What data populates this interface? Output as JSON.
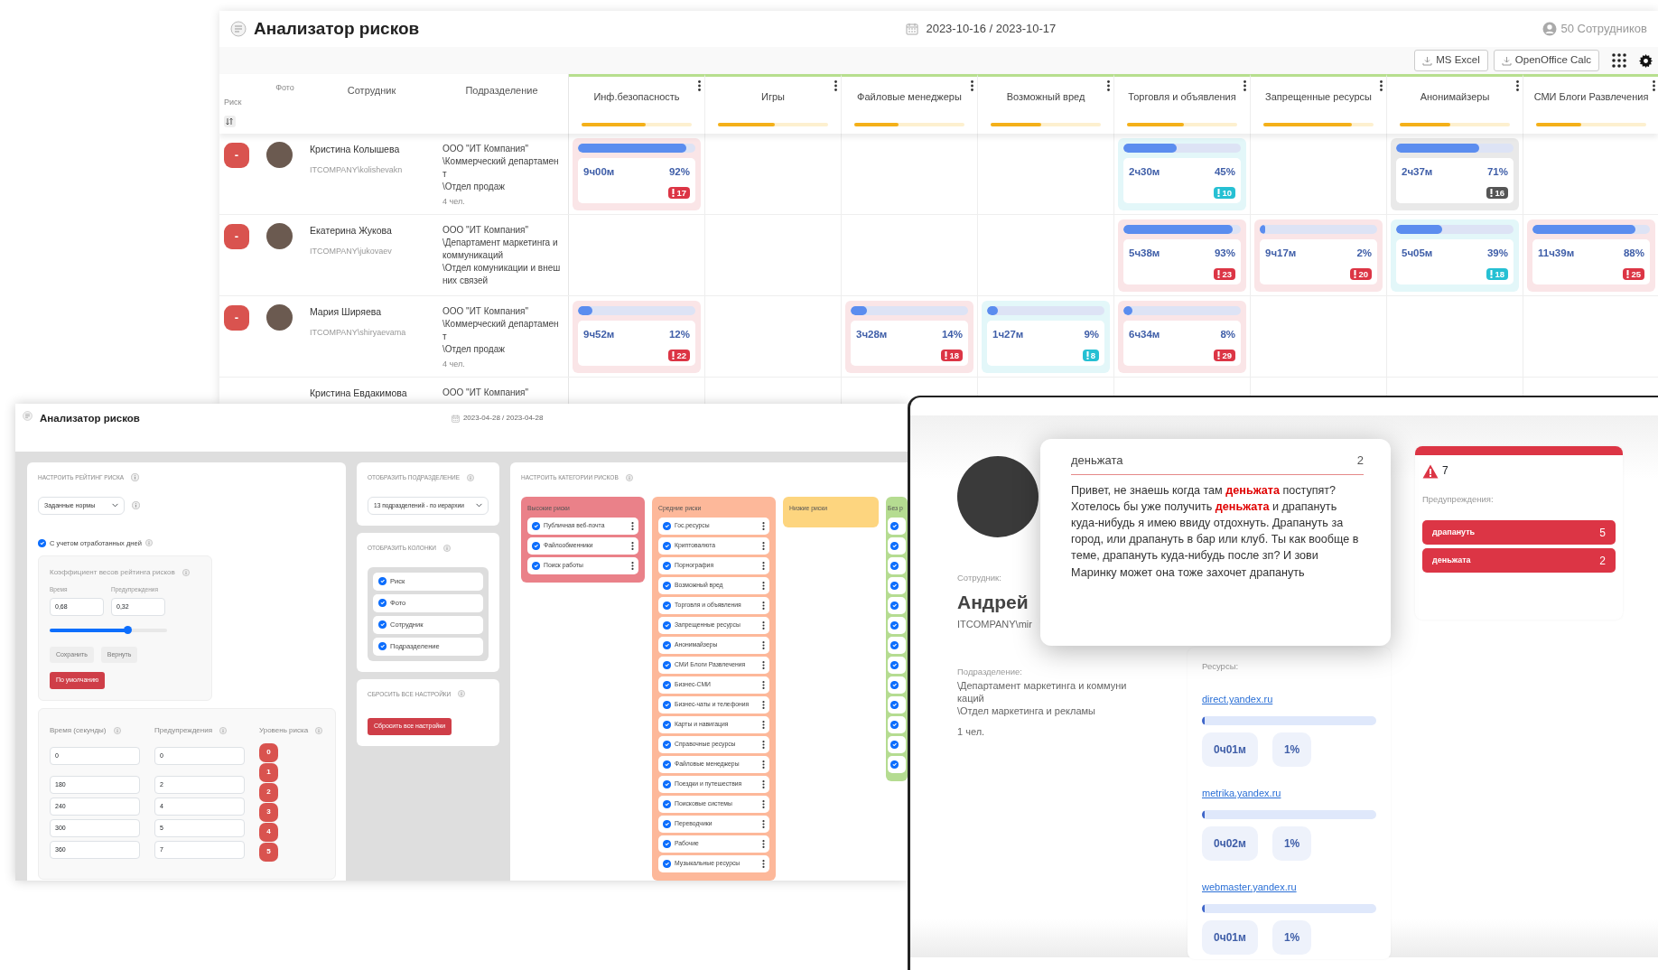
{
  "risk_window": {
    "title": "Анализатор рисков",
    "date_range": "2023-10-16 / 2023-10-17",
    "employees_count": "50 Сотрудников",
    "export_buttons": [
      "MS Excel",
      "OpenOffice Calc"
    ],
    "columns": [
      "Риск",
      "Фото",
      "Сотрудник",
      "Подразделение"
    ],
    "categories": [
      {
        "label": "Инф.безопасность",
        "level": 0.58
      },
      {
        "label": "Игры",
        "level": 0.52
      },
      {
        "label": "Файловые менеджеры",
        "level": 0.4
      },
      {
        "label": "Возможный вред",
        "level": 0.46
      },
      {
        "label": "Торговля и объявления",
        "level": 0.52
      },
      {
        "label": "Запрещенные ресурсы",
        "level": 0.8
      },
      {
        "label": "Анонимайзеры",
        "level": 0.46
      },
      {
        "label": "СМИ Блоги Развлечения",
        "level": 0.41
      }
    ],
    "rows": [
      {
        "risk": "-",
        "name": "Кристина Колышева",
        "login": "ITCOMPANY\\kolishevakn",
        "department": [
          "ООО \"ИТ Компания\"",
          "\\Коммерческий департамент",
          "\\Отдел продаж"
        ],
        "headcount": "4 чел.",
        "cells": [
          {
            "time": "9ч00м",
            "percent": "92%",
            "warnings": "17",
            "color": "#dc3545",
            "level": 0.92
          },
          null,
          null,
          null,
          {
            "time": "2ч30м",
            "percent": "45%",
            "warnings": "10",
            "color": "#26c0d3",
            "level": 0.45
          },
          null,
          {
            "time": "2ч37м",
            "percent": "71%",
            "warnings": "16",
            "color": "#555555",
            "level": 0.71
          },
          null
        ]
      },
      {
        "risk": "-",
        "name": "Екатерина Жукова",
        "login": "ITCOMPANY\\jukovaev",
        "department": [
          "ООО \"ИТ Компания\"",
          "\\Департамент маркетинга и коммуникаций",
          "\\Отдел комуникации и внешних связей"
        ],
        "cells": [
          null,
          null,
          null,
          null,
          {
            "time": "5ч38м",
            "percent": "93%",
            "warnings": "23",
            "color": "#dc3545",
            "level": 0.93
          },
          {
            "time": "9ч17м",
            "percent": "2%",
            "warnings": "20",
            "color": "#dc3545",
            "level": 0.02
          },
          {
            "time": "5ч05м",
            "percent": "39%",
            "warnings": "18",
            "color": "#26c0d3",
            "level": 0.39
          },
          {
            "time": "11ч39м",
            "percent": "88%",
            "warnings": "25",
            "color": "#dc3545",
            "level": 0.88
          }
        ]
      },
      {
        "risk": "-",
        "name": "Мария Ширяева",
        "login": "ITCOMPANY\\shiryaevama",
        "department": [
          "ООО \"ИТ Компания\"",
          "\\Коммерческий департамент",
          "\\Отдел продаж"
        ],
        "headcount": "4 чел.",
        "cells": [
          {
            "time": "9ч52м",
            "percent": "12%",
            "warnings": "22",
            "color": "#dc3545",
            "level": 0.12
          },
          null,
          {
            "time": "3ч28м",
            "percent": "14%",
            "warnings": "18",
            "color": "#dc3545",
            "level": 0.14
          },
          {
            "time": "1ч27м",
            "percent": "9%",
            "warnings": "8",
            "color": "#26c0d3",
            "level": 0.09
          },
          {
            "time": "6ч34м",
            "percent": "8%",
            "warnings": "29",
            "color": "#dc3545",
            "level": 0.08
          },
          null,
          null,
          null
        ]
      },
      {
        "name": "Кристина Евдакимова",
        "department": [
          "ООО \"ИТ Компания\""
        ],
        "cells": [
          null,
          null,
          null,
          null,
          null,
          null,
          null,
          null
        ]
      }
    ]
  },
  "settings_window": {
    "title": "Анализатор рисков",
    "date_range": "2023-04-28 / 2023-04-28",
    "rating": {
      "heading": "НАСТРОИТЬ РЕЙТИНГ РИСКА",
      "mode_select": "Заданные нормы",
      "worked_days": {
        "label": "С учетом отработанных дней",
        "checked": true
      },
      "weights": {
        "heading": "Коэффициент весов рейтинга рисков",
        "time_label": "Время",
        "warnings_label": "Предупреждения",
        "time_value": "0,68",
        "warnings_value": "0,32",
        "level": 0.66,
        "buttons": [
          "Сохранить",
          "Вернуть"
        ],
        "default_button": "По умолчанию"
      },
      "thresholds": {
        "columns": [
          "Время (секунды)",
          "Предупреждения",
          "Уровень риска"
        ],
        "rows": [
          {
            "time": "0",
            "warnings": "0"
          },
          {
            "time": "180",
            "warnings": "2"
          },
          {
            "time": "240",
            "warnings": "4"
          },
          {
            "time": "300",
            "warnings": "5"
          },
          {
            "time": "360",
            "warnings": "7"
          }
        ],
        "levels": [
          "0",
          "1",
          "2",
          "3",
          "4",
          "5"
        ]
      }
    },
    "departments": {
      "heading": "ОТОБРАЗИТЬ ПОДРАЗДЕЛЕНИЕ",
      "select": "13 подразделений - по иерархии"
    },
    "columns_panel": {
      "heading": "ОТОБРАЗИТЬ КОЛОНКИ",
      "items": [
        {
          "label": "Риск",
          "checked": true
        },
        {
          "label": "Фото",
          "checked": true
        },
        {
          "label": "Сотрудник",
          "checked": true
        },
        {
          "label": "Подразделение",
          "checked": true
        }
      ]
    },
    "reset": {
      "heading": "СБРОСИТЬ ВСЕ НАСТРОЙКИ",
      "button": "Сбросить все настройки"
    },
    "categories": {
      "heading": "НАСТРОИТЬ КАТЕГОРИИ РИСКОВ",
      "groups": [
        {
          "title": "Высокие риски",
          "color": "#ea8189",
          "items": [
            {
              "label": "Публичная веб-почта",
              "checked": true
            },
            {
              "label": "Файлообменники",
              "checked": true
            },
            {
              "label": "Поиск работы",
              "checked": true
            }
          ]
        },
        {
          "title": "Средние риски",
          "color": "#fdb89a",
          "items": [
            {
              "label": "Гос.ресурсы",
              "checked": true
            },
            {
              "label": "Криптовалюта",
              "checked": true
            },
            {
              "label": "Порнография",
              "checked": true
            },
            {
              "label": "Возможный вред",
              "checked": true
            },
            {
              "label": "Торговля и объявления",
              "checked": true
            },
            {
              "label": "Запрещенные ресурсы",
              "checked": true
            },
            {
              "label": "Анонимайзеры",
              "checked": true
            },
            {
              "label": "СМИ Блоги Развлечения",
              "checked": true
            },
            {
              "label": "Бизнес-СМИ",
              "checked": true
            },
            {
              "label": "Бизнес-чаты и телефония",
              "checked": true
            },
            {
              "label": "Карты и навигация",
              "checked": true
            },
            {
              "label": "Справочные ресурсы",
              "checked": true
            },
            {
              "label": "Файловые менеджеры",
              "checked": true
            },
            {
              "label": "Поездки и путешествия",
              "checked": true
            },
            {
              "label": "Поисковые системы",
              "checked": true
            },
            {
              "label": "Переводчики",
              "checked": true
            },
            {
              "label": "Рабочие",
              "checked": true
            },
            {
              "label": "Музыкальные ресурсы",
              "checked": true
            }
          ]
        },
        {
          "title": "Низкие риски",
          "color": "#fdd57f"
        },
        {
          "title": "Без р",
          "color": "#b5dc91",
          "items": [
            {
              "checked": true
            },
            {
              "checked": true
            },
            {
              "checked": true
            },
            {
              "checked": true
            },
            {
              "checked": true
            },
            {
              "checked": true
            },
            {
              "checked": true
            },
            {
              "checked": true
            },
            {
              "checked": true
            },
            {
              "checked": true
            },
            {
              "checked": true
            },
            {
              "checked": true
            },
            {
              "checked": true
            }
          ]
        }
      ]
    }
  },
  "employee_window": {
    "employee_label": "Сотрудник:",
    "name": "Андрей",
    "login": "ITCOMPANY\\mir",
    "department_label": "Подразделение:",
    "department": [
      "\\Департамент маркетинга и коммуникаций",
      "\\Отдел маркетинга и рекламы"
    ],
    "headcount": "1 чел.",
    "resources": {
      "heading": "Ресурсы:",
      "items": [
        {
          "url": "direct.yandex.ru",
          "level": 0.01,
          "time": "0ч01м",
          "percent": "1%"
        },
        {
          "url": "metrika.yandex.ru",
          "level": 0.01,
          "time": "0ч02м",
          "percent": "1%"
        },
        {
          "url": "webmaster.yandex.ru",
          "level": 0.01,
          "time": "0ч01м",
          "percent": "1%"
        }
      ]
    },
    "warnings": {
      "count": "7",
      "heading": "Предупреждения:",
      "items": [
        {
          "word": "драпануть",
          "count": "5"
        },
        {
          "word": "деньжата",
          "count": "2"
        }
      ]
    },
    "popup": {
      "word": "деньжата",
      "count": "2",
      "message": "Привет, не знаешь когда там **деньжата** поступят? Хотелось бы уже получить **деньжата** и драпануть куда-нибудь я имею ввиду отдохнуть. Драпануть за город, или драпануть в бар или клуб. Ты как вообще в теме, драпануть куда-нибудь после зп? И зови Маринку может она тоже захочет драпануть"
    }
  }
}
